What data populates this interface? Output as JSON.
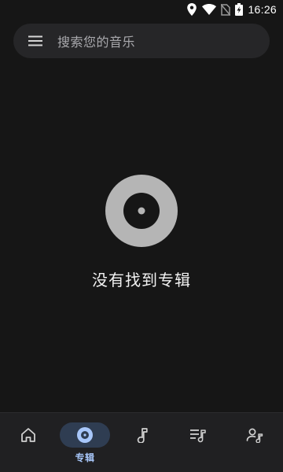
{
  "status_bar": {
    "time": "16:26",
    "icons": [
      "location-icon",
      "wifi-icon",
      "no-sim-icon",
      "battery-charging-icon"
    ]
  },
  "search": {
    "placeholder": "搜索您的音乐",
    "menu_icon": "menu-icon"
  },
  "empty_state": {
    "icon": "album-disc-icon",
    "message": "没有找到专辑"
  },
  "bottom_nav": {
    "items": [
      {
        "icon": "home-icon",
        "label": "",
        "active": false
      },
      {
        "icon": "album-icon",
        "label": "专辑",
        "active": true
      },
      {
        "icon": "music-note-icon",
        "label": "",
        "active": false
      },
      {
        "icon": "playlist-icon",
        "label": "",
        "active": false
      },
      {
        "icon": "artist-icon",
        "label": "",
        "active": false
      }
    ]
  },
  "colors": {
    "background": "#161616",
    "search_bg": "#262628",
    "nav_bg": "#202022",
    "accent": "#a8c7fa",
    "active_pill": "#2f3d52",
    "disc": "#b5b5b5"
  }
}
